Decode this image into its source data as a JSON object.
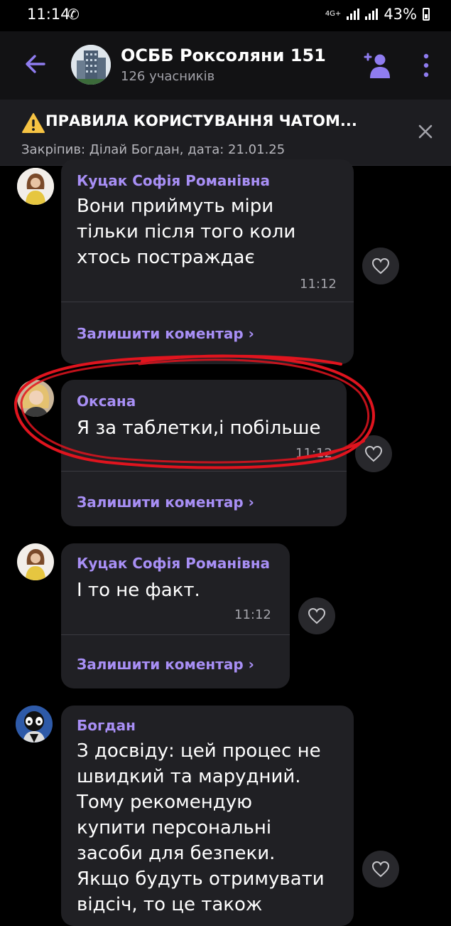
{
  "status_bar": {
    "time": "11:14",
    "network": "4G+",
    "battery": "43%"
  },
  "header": {
    "group_name": "ОСББ Роксоляни 151",
    "members": "126 учасників"
  },
  "pinned": {
    "title": "ПРАВИЛА КОРИСТУВАННЯ ЧАТОМ...",
    "meta": "Закріпив: Ділай Богдан, дата: 21.01.25"
  },
  "messages": [
    {
      "sender": "Куцак Софія Романівна",
      "lines": [
        "Вони приймуть міри",
        "тільки після того коли",
        "хтось постраждає"
      ],
      "time": "11:12",
      "reply": "Залишити коментар ›"
    },
    {
      "sender": "Оксана",
      "lines": [
        "Я за таблетки,і побільше"
      ],
      "time": "11:12",
      "reply": "Залишити коментар ›"
    },
    {
      "sender": "Куцак Софія Романівна",
      "lines": [
        "І то не факт."
      ],
      "time": "11:12",
      "reply": "Залишити коментар ›"
    },
    {
      "sender": "Богдан",
      "lines": [
        "З досвіду: цей процес не",
        "швидкий та марудний.",
        "Тому рекомендую",
        "купити персональні",
        "засоби для безпеки.",
        "Якщо будуть отримувати",
        "відсіч, то це також"
      ]
    }
  ],
  "colors": {
    "accent": "#a88ff5",
    "bubble": "#202024",
    "header": "#121214",
    "annotation": "#e0141e"
  }
}
